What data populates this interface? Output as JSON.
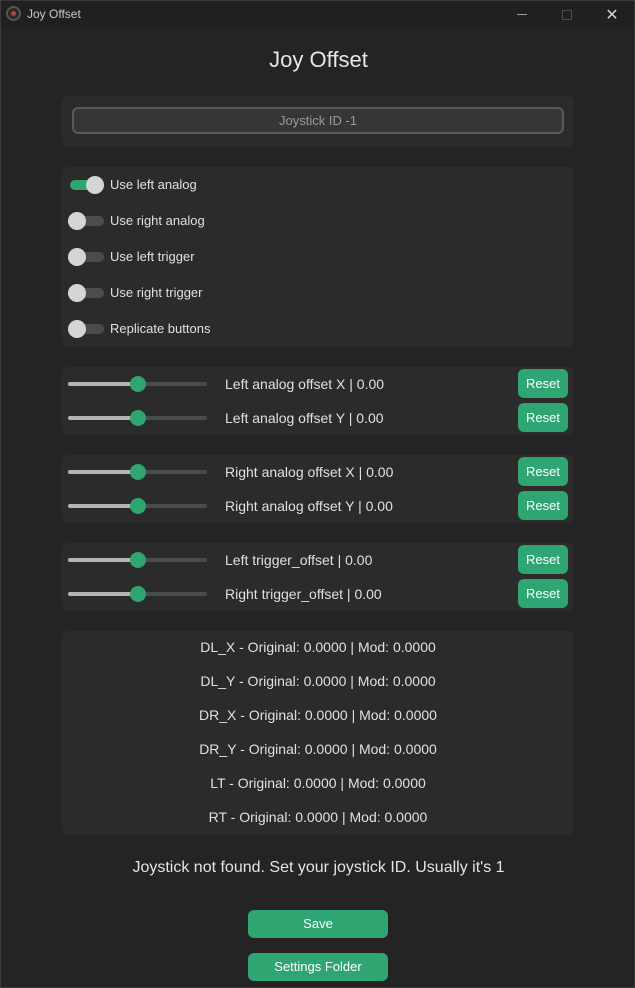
{
  "window": {
    "title": "Joy Offset",
    "controls": {
      "minimize": "minimize-icon",
      "maximize": "maximize-icon",
      "close": "close-icon"
    }
  },
  "heading": "Joy Offset",
  "joystick_id": {
    "value": "Joystick ID -1",
    "placeholder": "Joystick ID -1"
  },
  "switches": [
    {
      "label": "Use left analog",
      "on": true
    },
    {
      "label": "Use right analog",
      "on": false
    },
    {
      "label": "Use left trigger",
      "on": false
    },
    {
      "label": "Use right trigger",
      "on": false
    },
    {
      "label": "Replicate buttons",
      "on": false
    }
  ],
  "sliders": [
    {
      "label": "Left analog offset X  |  0.00",
      "value": 0.5,
      "button": "Reset"
    },
    {
      "label": "Left analog offset Y  |  0.00",
      "value": 0.5,
      "button": "Reset"
    },
    {
      "label": "Right analog offset X  |  0.00",
      "value": 0.5,
      "button": "Reset"
    },
    {
      "label": "Right analog offset Y  |  0.00",
      "value": 0.5,
      "button": "Reset"
    },
    {
      "label": "Left trigger_offset  |  0.00",
      "value": 0.5,
      "button": "Reset"
    },
    {
      "label": "Right trigger_offset  |  0.00",
      "value": 0.5,
      "button": "Reset"
    }
  ],
  "stats": [
    "DL_X - Original: 0.0000 | Mod: 0.0000",
    "DL_Y - Original: 0.0000 | Mod: 0.0000",
    "DR_X - Original: 0.0000 | Mod: 0.0000",
    "DR_Y - Original: 0.0000 | Mod: 0.0000",
    "LT - Original: 0.0000 | Mod: 0.0000",
    "RT - Original: 0.0000 | Mod: 0.0000"
  ],
  "status_message": "Joystick not found. Set your joystick ID. Usually it's 1",
  "buttons": {
    "save": "Save",
    "settings_folder": "Settings Folder"
  },
  "colors": {
    "accent": "#2fa572",
    "background": "#242424",
    "panel": "#2b2b2b"
  }
}
